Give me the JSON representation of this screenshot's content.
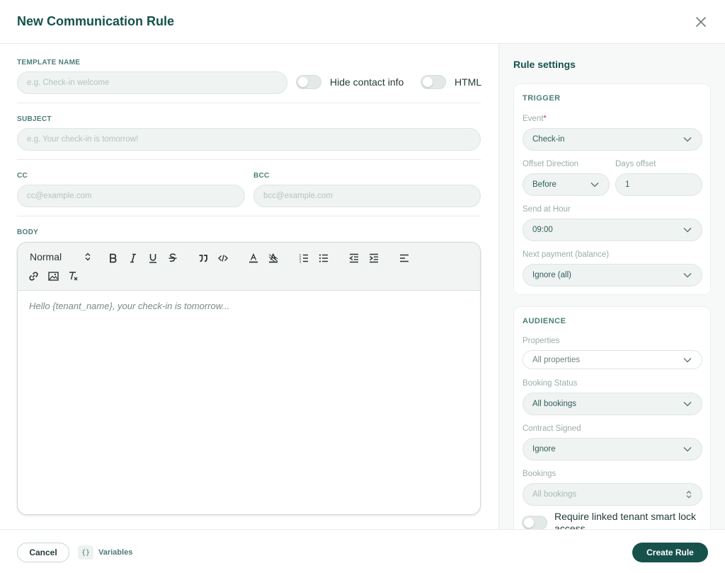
{
  "dialog": {
    "title": "New Communication Rule"
  },
  "form": {
    "template_name": {
      "label": "TEMPLATE NAME",
      "placeholder": "e.g. Check-in welcome",
      "value": ""
    },
    "hide_contact_info": {
      "label": "Hide contact info",
      "on": false
    },
    "html_toggle": {
      "label": "HTML",
      "on": false
    },
    "subject": {
      "label": "SUBJECT",
      "placeholder": "e.g. Your check-in is tomorrow!",
      "value": ""
    },
    "cc": {
      "label": "CC",
      "placeholder": "cc@example.com",
      "value": ""
    },
    "bcc": {
      "label": "BCC",
      "placeholder": "bcc@example.com",
      "value": ""
    },
    "body": {
      "label": "BODY",
      "heading_format": "Normal",
      "placeholder": "Hello {tenant_name}, your check-in is tomorrow..."
    }
  },
  "settings": {
    "title": "Rule settings",
    "trigger": {
      "title": "TRIGGER",
      "event_label": "Event",
      "event_required_mark": "*",
      "event_value": "Check-in",
      "offset_direction_label": "Offset Direction",
      "offset_direction_value": "Before",
      "days_offset_label": "Days offset",
      "days_offset_value": "1",
      "send_hour_label": "Send at Hour",
      "send_hour_value": "09:00",
      "next_payment_label": "Next payment (balance)",
      "next_payment_value": "Ignore (all)"
    },
    "audience": {
      "title": "AUDIENCE",
      "properties_label": "Properties",
      "properties_value": "All properties",
      "booking_status_label": "Booking Status",
      "booking_status_value": "All bookings",
      "contract_signed_label": "Contract Signed",
      "contract_signed_value": "Ignore",
      "bookings_label": "Bookings",
      "bookings_value": "All bookings",
      "smart_lock_label": "Require linked tenant smart lock access",
      "smart_lock_on": false
    }
  },
  "footer": {
    "cancel_label": "Cancel",
    "variables_icon": "{}",
    "variables_label": "Variables",
    "create_label": "Create Rule"
  },
  "colors": {
    "brand": "#17514c",
    "label": "#4c7d76",
    "required": "#d63b3b"
  }
}
